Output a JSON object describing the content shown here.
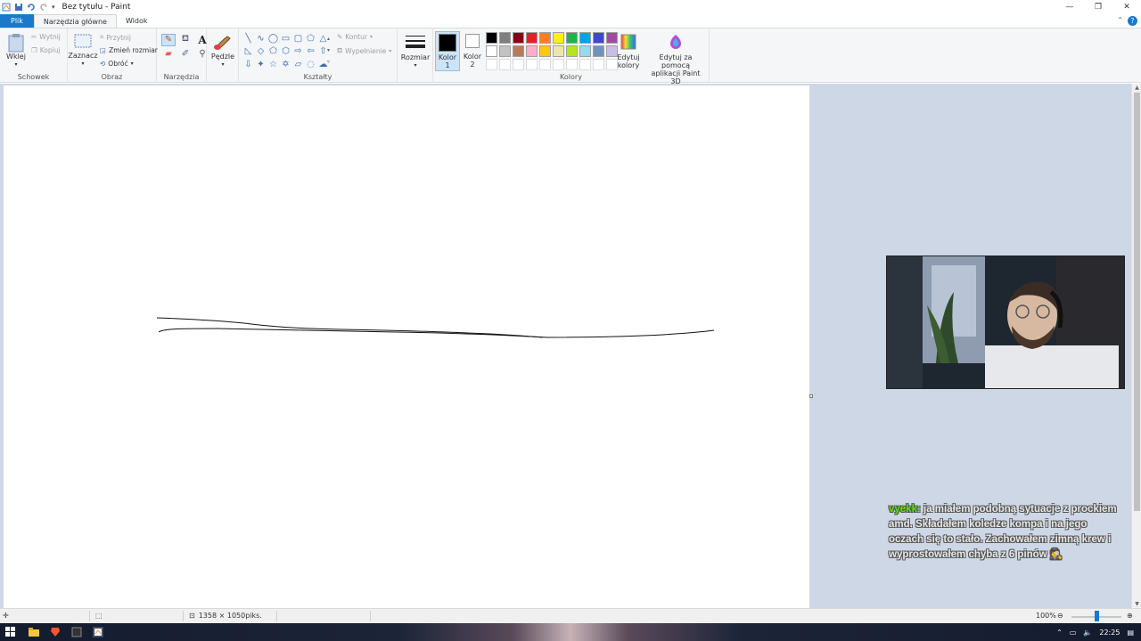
{
  "window": {
    "title": "Bez tytułu - Paint"
  },
  "tabs": [
    {
      "label": "Plik"
    },
    {
      "label": "Narzędzia główne"
    },
    {
      "label": "Widok"
    }
  ],
  "ribbon": {
    "clipboard": {
      "group_label": "Schowek",
      "paste": "Wklej",
      "cut": "Wytnij",
      "copy": "Kopiuj"
    },
    "image": {
      "group_label": "Obraz",
      "select": "Zaznacz",
      "crop": "Przytnij",
      "resize": "Zmień rozmiar",
      "rotate": "Obróć"
    },
    "tools": {
      "group_label": "Narzędzia"
    },
    "brushes": {
      "label": "Pędzle"
    },
    "shapes": {
      "group_label": "Kształty",
      "outline": "Kontur",
      "fill": "Wypełnienie"
    },
    "size": {
      "label": "Rozmiar"
    },
    "colors": {
      "group_label": "Kolory",
      "color1": "Kolor\n1",
      "color1_a": "Kolor",
      "color1_b": "1",
      "color2_a": "Kolor",
      "color2_b": "2",
      "color1_value": "#000000",
      "color2_value": "#ffffff",
      "edit_a": "Edytuj",
      "edit_b": "kolory",
      "paint3d_a": "Edytuj za pomocą",
      "paint3d_b": "aplikacji Paint 3D",
      "palette_row1": [
        "#000000",
        "#7f7f7f",
        "#880015",
        "#ed1c24",
        "#ff7f27",
        "#fff200",
        "#22b14c",
        "#00a2e8",
        "#3f48cc",
        "#a349a4"
      ],
      "palette_row2": [
        "#ffffff",
        "#c3c3c3",
        "#b97a57",
        "#ffaec9",
        "#ffc90e",
        "#efe4b0",
        "#b5e61d",
        "#99d9ea",
        "#7092be",
        "#c8bfe7"
      ]
    }
  },
  "chat": {
    "user": "vyekk:",
    "message": " ja miałem podobną sytuacje z prockiem amd. Składałem koledze kompa i na jego oczach się to stało. Zachowałem zimną krew i wyprostowałem chyba z 6 pinów 🕵"
  },
  "statusbar": {
    "canvas_size": "1358 × 1050piks.",
    "zoom": "100%"
  },
  "taskbar": {
    "time": "22:25"
  },
  "colors": {
    "accent": "#1979ca",
    "workspace_bg": "#cdd7e6",
    "chat_user": "#5ee000"
  }
}
